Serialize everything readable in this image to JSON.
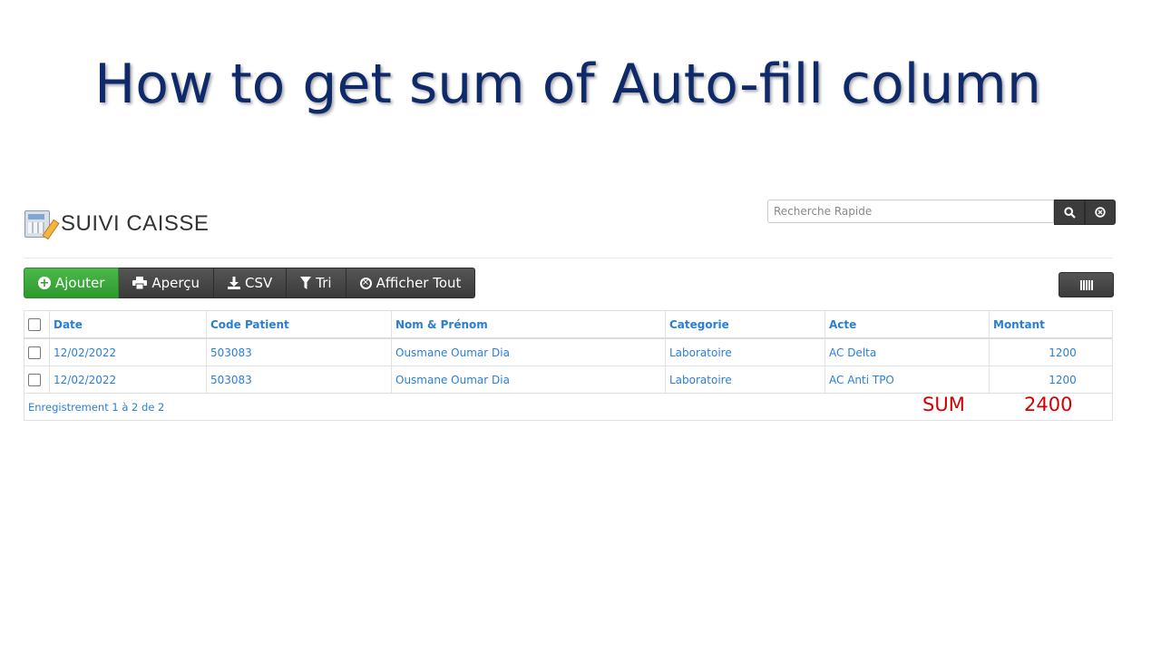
{
  "slide": {
    "title": "How to get sum of Auto-fill column"
  },
  "header": {
    "title": "SUIVI CAISSE",
    "icon": "calculator-pencil-icon"
  },
  "search": {
    "placeholder": "Recherche Rapide",
    "value": ""
  },
  "toolbar": {
    "add_label": "Ajouter",
    "preview_label": "Aperçu",
    "csv_label": "CSV",
    "sort_label": "Tri",
    "show_all_label": "Afficher Tout"
  },
  "table": {
    "columns": [
      "Date",
      "Code Patient",
      "Nom & Prénom",
      "Categorie",
      "Acte",
      "Montant"
    ],
    "rows": [
      [
        "12/02/2022",
        "503083",
        "Ousmane Oumar Dia",
        "Laboratoire",
        "AC Delta",
        "1200"
      ],
      [
        "12/02/2022",
        "503083",
        "Ousmane Oumar Dia",
        "Laboratoire",
        "AC Anti TPO",
        "1200"
      ]
    ],
    "footer": "Enregistrement 1 à 2 de 2"
  },
  "sum": {
    "label": "SUM",
    "value": "2400"
  },
  "colors": {
    "title": "#0f2a6b",
    "link": "#2a7fd4",
    "green": "#2e9a2e",
    "sum": "#d40000"
  }
}
